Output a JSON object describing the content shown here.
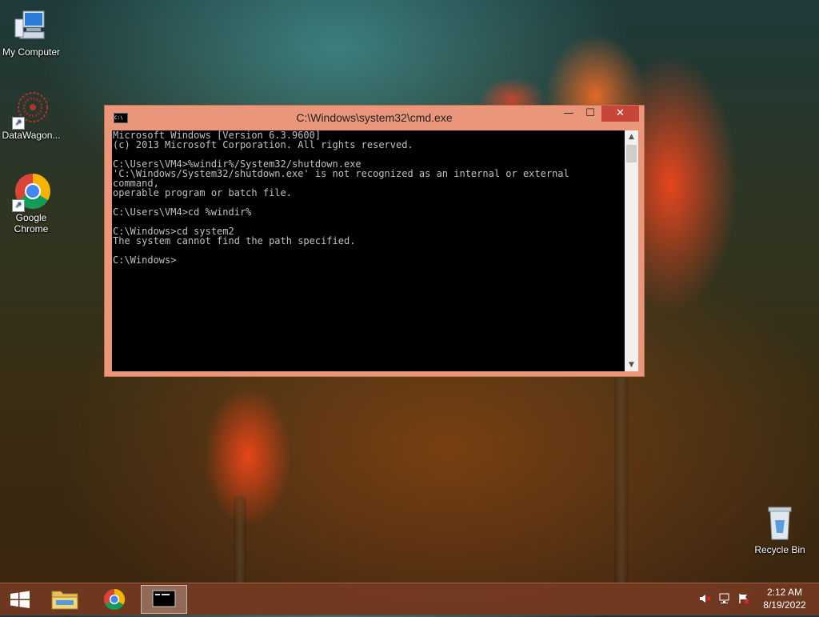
{
  "desktop": {
    "icons": [
      {
        "label": "My Computer",
        "icon": "computer-icon"
      },
      {
        "label": "DataWagon...",
        "icon": "datawagon-icon"
      },
      {
        "label": "Google Chrome",
        "icon": "chrome-icon"
      },
      {
        "label": "Recycle Bin",
        "icon": "recycle-bin-icon"
      }
    ]
  },
  "cmd_window": {
    "title": "C:\\Windows\\system32\\cmd.exe",
    "icon_text": "C:\\",
    "buttons": {
      "minimize": "—",
      "maximize": "☐",
      "close": "✕"
    },
    "console_text": "Microsoft Windows [Version 6.3.9600]\n(c) 2013 Microsoft Corporation. All rights reserved.\n\nC:\\Users\\VM4>%windir%/System32/shutdown.exe\n'C:\\Windows/System32/shutdown.exe' is not recognized as an internal or external\ncommand,\noperable program or batch file.\n\nC:\\Users\\VM4>cd %windir%\n\nC:\\Windows>cd system2\nThe system cannot find the path specified.\n\nC:\\Windows>",
    "scroll_up": "▲",
    "scroll_down": "▼"
  },
  "taskbar": {
    "items": [
      {
        "name": "start-button",
        "icon": "windows-logo-icon"
      },
      {
        "name": "file-explorer",
        "icon": "folder-icon"
      },
      {
        "name": "chrome",
        "icon": "chrome-icon"
      },
      {
        "name": "cmd",
        "icon": "cmd-icon",
        "active": true
      }
    ],
    "tray": {
      "volume_icon": "speaker-muted-icon",
      "network_icon": "network-icon",
      "flag_icon": "action-center-icon"
    },
    "clock": {
      "time": "2:12 AM",
      "date": "8/19/2022"
    }
  },
  "colors": {
    "window_frame": "#e9967a",
    "close_button": "#c7463a",
    "console_bg": "#000000",
    "console_text": "#c0c0c0"
  }
}
